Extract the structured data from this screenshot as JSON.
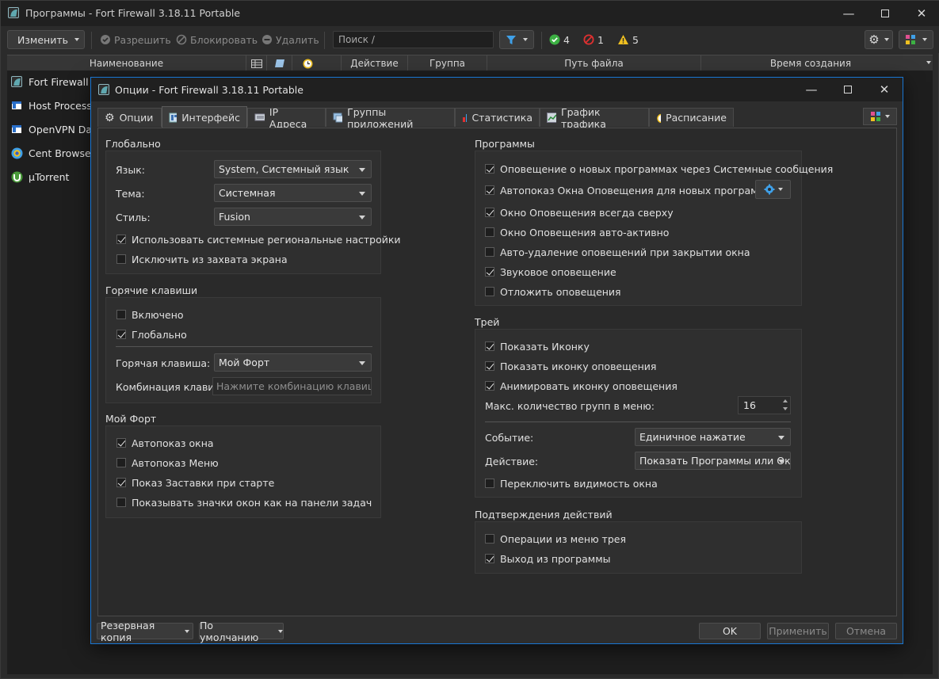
{
  "main": {
    "title": "Программы - Fort Firewall 3.18.11 Portable",
    "toolbar": {
      "edit": "Изменить",
      "allow": "Разрешить",
      "block": "Блокировать",
      "delete": "Удалить",
      "search_placeholder": "Поиск /",
      "allowed_count": "4",
      "blocked_count": "1",
      "warning_count": "5"
    },
    "columns": {
      "name": "Наименование",
      "action": "Действие",
      "group": "Группа",
      "path": "Путь файла",
      "created": "Время создания"
    },
    "programs": [
      {
        "name": "Fort Firewall",
        "icon": "fort-icon"
      },
      {
        "name": "Host Process f",
        "icon": "window-icon"
      },
      {
        "name": "OpenVPN Dae",
        "icon": "window-icon"
      },
      {
        "name": "Cent Browser",
        "icon": "browser-icon"
      },
      {
        "name": "µTorrent",
        "icon": "utorrent-icon"
      }
    ]
  },
  "dialog": {
    "title": "Опции - Fort Firewall 3.18.11 Portable",
    "tabs": [
      "Опции",
      "Интерфейс",
      "IP Адреса",
      "Группы приложений",
      "Статистика",
      "График трафика",
      "Расписание"
    ],
    "active_tab": "Интерфейс",
    "global": {
      "title": "Глобально",
      "language_label": "Язык:",
      "language_value": "System, Системный язык",
      "theme_label": "Тема:",
      "theme_value": "Системная",
      "style_label": "Стиль:",
      "style_value": "Fusion",
      "use_regional": "Использовать системные региональные настройки",
      "exclude_capture": "Исключить из захвата экрана"
    },
    "hotkeys": {
      "title": "Горячие клавиши",
      "enabled": "Включено",
      "global": "Глобально",
      "hotkey_label": "Горячая клавиша:",
      "hotkey_value": "Мой Форт",
      "combo_label": "Комбинация клавиш:",
      "combo_placeholder": "Нажмите комбинацию клавиш"
    },
    "my_fort": {
      "title": "Мой Форт",
      "autoshow_window": "Автопоказ окна",
      "autoshow_menu": "Автопоказ Меню",
      "splash": "Показ Заставки при старте",
      "taskbar_icons": "Показывать значки окон как на панели задач"
    },
    "programs": {
      "title": "Программы",
      "notify_system": "Оповещение о новых программах через Системные сообщения",
      "autoshow_alert": "Автопоказ Окна Оповещения для новых программ",
      "alert_on_top": "Окно Оповещения всегда сверху",
      "alert_auto_active": "Окно Оповещения авто-активно",
      "auto_delete": "Авто-удаление оповещений при закрытии окна",
      "sound": "Звуковое оповещение",
      "postpone": "Отложить оповещения"
    },
    "tray": {
      "title": "Трей",
      "show_icon": "Показать Иконку",
      "show_alert_icon": "Показать иконку оповещения",
      "animate_alert_icon": "Анимировать иконку оповещения",
      "max_groups_label": "Макс. количество групп в меню:",
      "max_groups_value": "16",
      "event_label": "Событие:",
      "event_value": "Единичное нажатие",
      "action_label": "Действие:",
      "action_value": "Показать Программы или Окно",
      "toggle_visibility": "Переключить видимость окна"
    },
    "confirm": {
      "title": "Подтверждения действий",
      "tray_ops": "Операции из меню трея",
      "exit": "Выход из программы"
    },
    "footer": {
      "backup": "Резервная копия",
      "defaults": "По умолчанию",
      "ok": "OK",
      "apply": "Применить",
      "cancel": "Отмена"
    }
  },
  "colors": {
    "accent": "#1976d2",
    "allow": "#3cb043",
    "block": "#e03030",
    "warn": "#f0c020"
  }
}
